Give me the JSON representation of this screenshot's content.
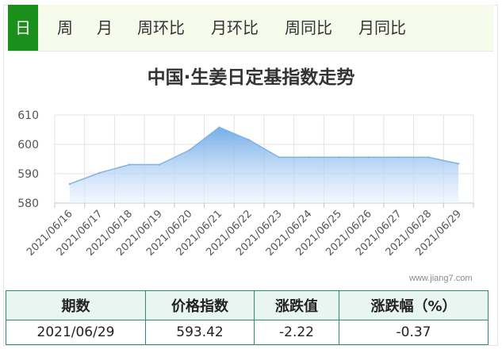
{
  "tabs": [
    {
      "label": "日",
      "active": true
    },
    {
      "label": "周",
      "active": false
    },
    {
      "label": "月",
      "active": false
    },
    {
      "label": "周环比",
      "active": false
    },
    {
      "label": "月环比",
      "active": false
    },
    {
      "label": "周同比",
      "active": false
    },
    {
      "label": "月同比",
      "active": false
    }
  ],
  "colors": {
    "tab_active_bg": "#1b8f1b",
    "series_line": "#7fb2e5",
    "series_fill_top": "#6fa9e8",
    "series_fill_bottom": "#eaf3fd",
    "table_border": "#2f8b6e"
  },
  "chart_data": {
    "type": "area",
    "title": "中国·生姜日定基指数走势",
    "categories": [
      "2021/06/16",
      "2021/06/17",
      "2021/06/18",
      "2021/06/19",
      "2021/06/20",
      "2021/06/21",
      "2021/06/22",
      "2021/06/23",
      "2021/06/24",
      "2021/06/25",
      "2021/06/26",
      "2021/06/27",
      "2021/06/28",
      "2021/06/29"
    ],
    "series": [
      {
        "values": [
          586.5,
          590.3,
          593.1,
          593.1,
          598.0,
          605.8,
          601.5,
          595.6,
          595.6,
          595.6,
          595.6,
          595.6,
          595.6,
          593.4
        ]
      }
    ],
    "ylim": [
      580,
      610
    ],
    "yticks": [
      580,
      590,
      600,
      610
    ],
    "grid": true
  },
  "watermark": "www.jiang7.com",
  "summary": {
    "headers": [
      "期数",
      "价格指数",
      "涨跌值",
      "涨跌幅（%）"
    ],
    "row": [
      "2021/06/29",
      "593.42",
      "-2.22",
      "-0.37"
    ]
  }
}
